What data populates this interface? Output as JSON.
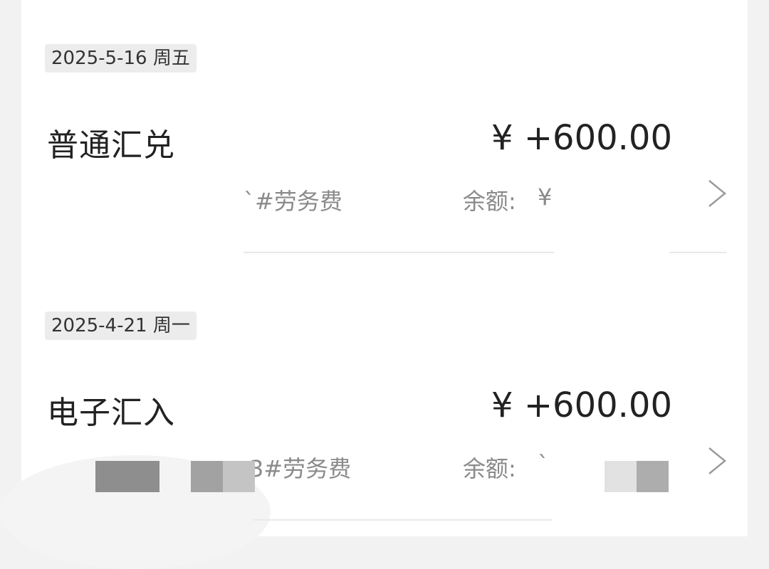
{
  "transactions": [
    {
      "date": "2025-5-16 周五",
      "title": "普通汇兑",
      "amount": "¥ +600.00",
      "remark_visible": "`#劳务费",
      "balance_label": "余额:",
      "balance_value_visible": "¥"
    },
    {
      "date": "2025-4-21 周一",
      "title": "电子汇入",
      "amount": "¥ +600.00",
      "remark_visible": "3#劳务费",
      "balance_label": "余额:",
      "balance_value_visible": "`"
    }
  ],
  "icons": {
    "detail_arrow": "chevron-right-icon"
  }
}
